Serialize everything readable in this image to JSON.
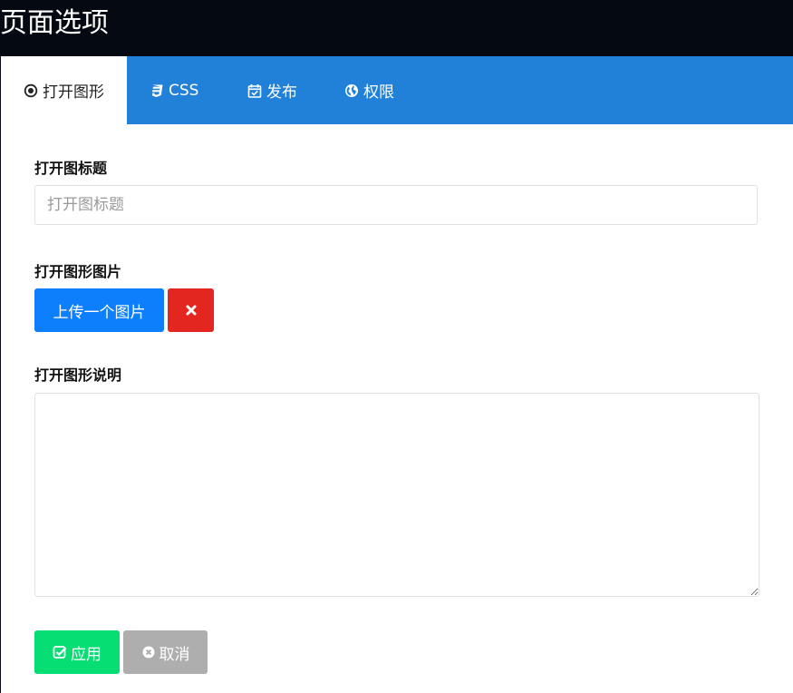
{
  "window": {
    "title": "页面选项"
  },
  "tabs": [
    {
      "label": "打开图形",
      "icon": "dot-circle-icon",
      "active": true
    },
    {
      "label": "CSS",
      "icon": "css3-icon",
      "active": false
    },
    {
      "label": "发布",
      "icon": "calendar-check-icon",
      "active": false
    },
    {
      "label": "权限",
      "icon": "globe-icon",
      "active": false
    }
  ],
  "form": {
    "title_label": "打开图标题",
    "title_placeholder": "打开图标题",
    "title_value": "",
    "image_label": "打开图形图片",
    "upload_button": "上传一个图片",
    "remove_icon": "times-icon",
    "description_label": "打开图形说明",
    "description_value": ""
  },
  "actions": {
    "apply_label": "应用",
    "apply_icon": "check-square-icon",
    "cancel_label": "取消",
    "cancel_icon": "times-circle-icon"
  },
  "colors": {
    "title_bar": "#050a12",
    "tab_bar": "#2180d7",
    "upload": "#0e7ffc",
    "remove": "#e3261f",
    "apply": "#06dd72",
    "cancel": "#aeaeae"
  }
}
